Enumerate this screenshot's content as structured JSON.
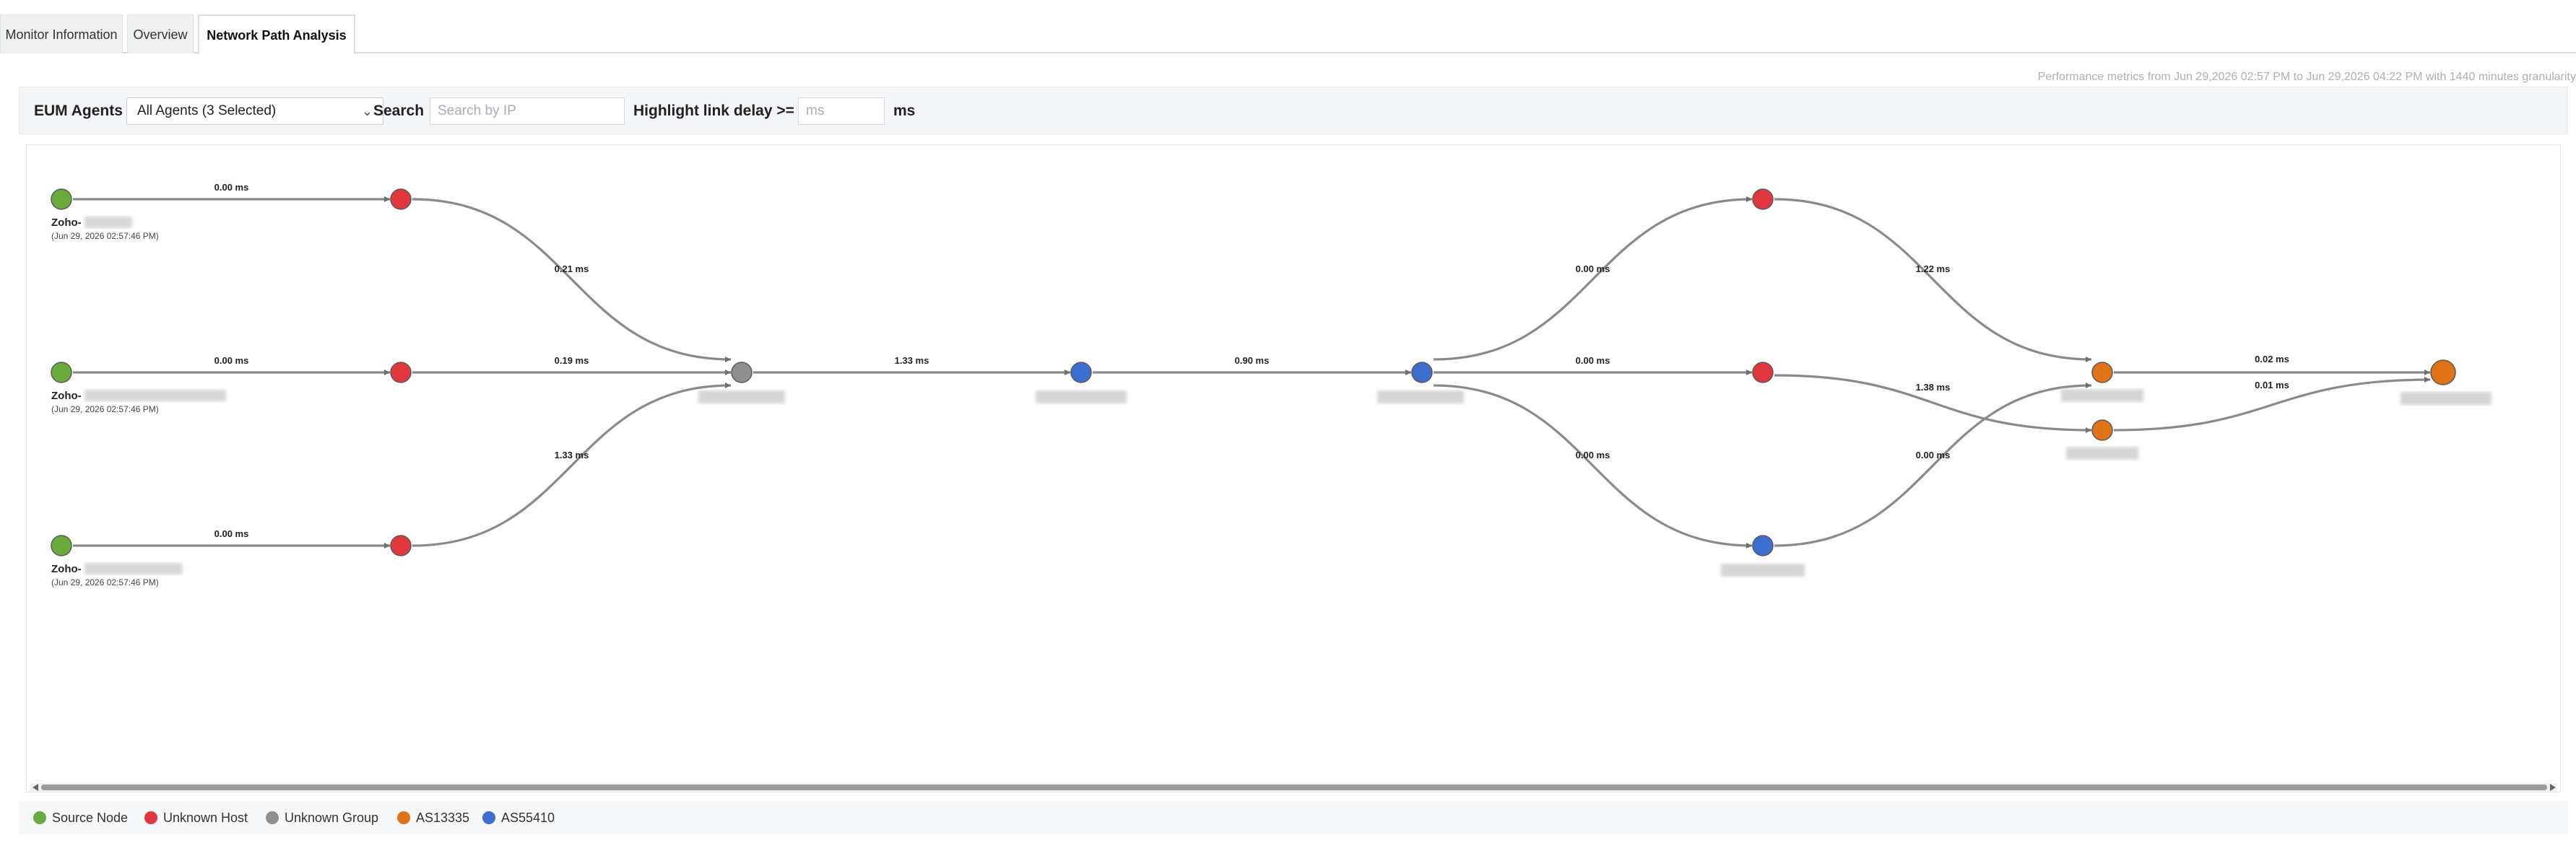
{
  "tabs": [
    "Monitor Information",
    "Overview",
    "Network Path Analysis"
  ],
  "performance_text": "Performance metrics from Jun 29,2026 02:57 PM to Jun 29,2026 04:22 PM with 1440 minutes granularity",
  "toolbar": {
    "agents_label": "EUM Agents",
    "agents_value": "All Agents (3 Selected)",
    "search_label": "Search",
    "search_placeholder": "Search by IP",
    "delay_label": "Highlight link delay >=",
    "delay_placeholder": "ms",
    "unit": "ms"
  },
  "colors": {
    "source": "#6aab3f",
    "unknown_host": "#e0383e",
    "unknown_group": "#8f8f8f",
    "as13335": "#e07218",
    "as55410": "#3d6fd1"
  },
  "graph": {
    "nodes": [
      {
        "id": "s1",
        "type": "source",
        "label": "Zoho-",
        "sublabel": "(Jun 29, 2026 02:57:46 PM)"
      },
      {
        "id": "s2",
        "type": "source",
        "label": "Zoho-",
        "sublabel": "(Jun 29, 2026 02:57:46 PM)"
      },
      {
        "id": "s3",
        "type": "source",
        "label": "Zoho-",
        "sublabel": "(Jun 29, 2026 02:57:46 PM)"
      },
      {
        "id": "h1",
        "type": "unknown_host"
      },
      {
        "id": "h2",
        "type": "unknown_host"
      },
      {
        "id": "h3",
        "type": "unknown_host"
      },
      {
        "id": "g1",
        "type": "unknown_group"
      },
      {
        "id": "b1",
        "type": "as55410"
      },
      {
        "id": "b2",
        "type": "as55410"
      },
      {
        "id": "h4",
        "type": "unknown_host"
      },
      {
        "id": "h5",
        "type": "unknown_host"
      },
      {
        "id": "b3",
        "type": "as55410"
      },
      {
        "id": "o1",
        "type": "as13335"
      },
      {
        "id": "o2",
        "type": "as13335"
      },
      {
        "id": "o3",
        "type": "as13335"
      }
    ],
    "edges": [
      {
        "from": "s1",
        "to": "h1",
        "delay": "0.00 ms"
      },
      {
        "from": "s2",
        "to": "h2",
        "delay": "0.00 ms"
      },
      {
        "from": "s3",
        "to": "h3",
        "delay": "0.00 ms"
      },
      {
        "from": "h1",
        "to": "g1",
        "delay": "0.21 ms"
      },
      {
        "from": "h2",
        "to": "g1",
        "delay": "0.19 ms"
      },
      {
        "from": "h3",
        "to": "g1",
        "delay": "1.33 ms"
      },
      {
        "from": "g1",
        "to": "b1",
        "delay": "1.33 ms"
      },
      {
        "from": "b1",
        "to": "b2",
        "delay": "0.90 ms"
      },
      {
        "from": "b2",
        "to": "h4",
        "delay": "0.00 ms"
      },
      {
        "from": "b2",
        "to": "h5",
        "delay": "0.00 ms"
      },
      {
        "from": "b2",
        "to": "b3",
        "delay": "0.00 ms"
      },
      {
        "from": "h4",
        "to": "o1",
        "delay": "1.22 ms"
      },
      {
        "from": "h5",
        "to": "o2",
        "delay": "1.38 ms"
      },
      {
        "from": "b3",
        "to": "o1",
        "delay": "0.00 ms"
      },
      {
        "from": "o1",
        "to": "o3",
        "delay": "0.02 ms"
      },
      {
        "from": "o2",
        "to": "o3",
        "delay": "0.01 ms"
      }
    ]
  },
  "legend": [
    {
      "label": "Source Node",
      "color": "#6aab3f"
    },
    {
      "label": "Unknown Host",
      "color": "#e0383e"
    },
    {
      "label": "Unknown Group",
      "color": "#8f8f8f"
    },
    {
      "label": "AS13335",
      "color": "#e07218"
    },
    {
      "label": "AS55410",
      "color": "#3d6fd1"
    }
  ]
}
